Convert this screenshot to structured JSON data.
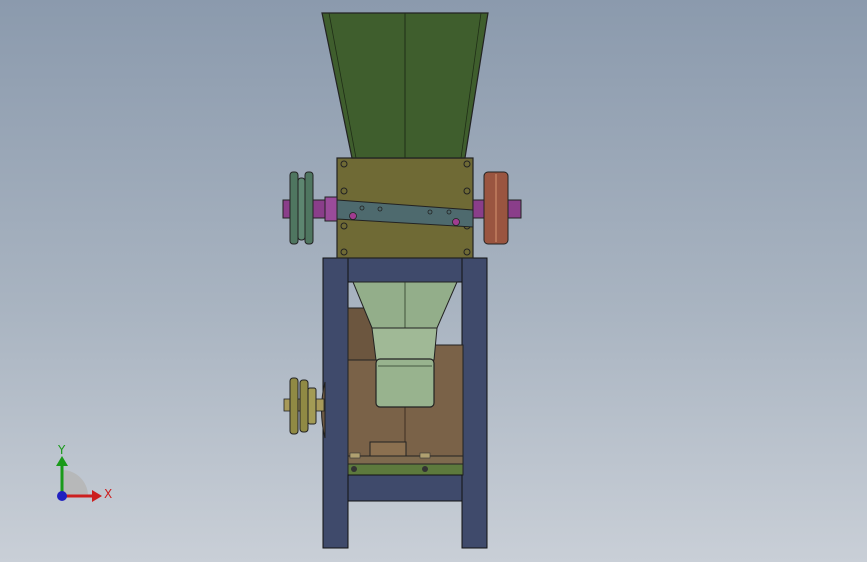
{
  "triad": {
    "y_label": "Y",
    "x_label": "X",
    "y_color": "#1a9a1a",
    "x_color": "#cc1f1f",
    "z_color": "#2020c0"
  },
  "colors": {
    "hopper": "#3f5e2d",
    "housing": "#6f6a35",
    "frame": "#3f4a6b",
    "shaft": "#8a3e8a",
    "pulley_left": "#4f7660",
    "roller_right": "#9a5540",
    "chute": "#93ae8a",
    "motor": "#7a6248",
    "pulley_lower": "#908a44"
  }
}
